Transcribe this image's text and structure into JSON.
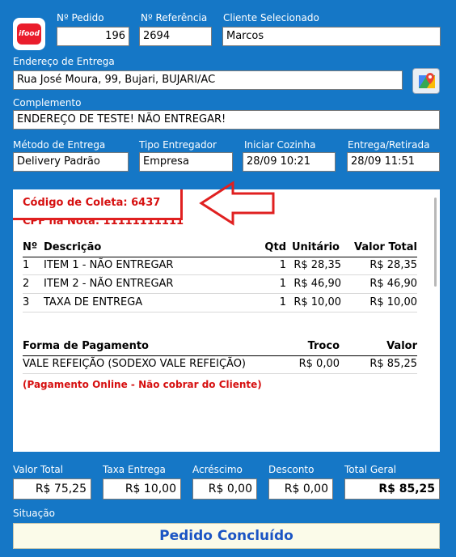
{
  "logo": {
    "text": "ifood"
  },
  "header": {
    "pedido_label": "Nº Pedido",
    "pedido_value": "196",
    "referencia_label": "Nº Referência",
    "referencia_value": "2694",
    "cliente_label": "Cliente Selecionado",
    "cliente_value": "Marcos"
  },
  "endereco": {
    "label": "Endereço de Entrega",
    "value": "Rua José Moura, 99, Bujari, BUJARI/AC"
  },
  "complemento": {
    "label": "Complemento",
    "value": "ENDEREÇO DE TESTE! NÃO ENTREGAR!"
  },
  "entrega": {
    "metodo_label": "Método de Entrega",
    "metodo_value": "Delivery Padrão",
    "tipo_label": "Tipo Entregador",
    "tipo_value": "Empresa",
    "cozinha_label": "Iniciar Cozinha",
    "cozinha_value": "28/09 10:21",
    "retirada_label": "Entrega/Retirada",
    "retirada_value": "28/09 11:51"
  },
  "receipt": {
    "codigo_coleta": "Código de Coleta: 6437",
    "cpf": "CPF na Nota: 11111111111",
    "items_header": {
      "num": "Nº",
      "descricao": "Descrição",
      "qtd": "Qtd",
      "unitario": "Unitário",
      "total": "Valor Total"
    },
    "items": [
      {
        "num": "1",
        "descricao": "ITEM 1 - NÃO ENTREGAR",
        "qtd": "1",
        "unitario": "R$ 28,35",
        "total": "R$ 28,35"
      },
      {
        "num": "2",
        "descricao": "ITEM 2 - NÃO ENTREGAR",
        "qtd": "1",
        "unitario": "R$ 46,90",
        "total": "R$ 46,90"
      },
      {
        "num": "3",
        "descricao": "TAXA DE ENTREGA",
        "qtd": "1",
        "unitario": "R$ 10,00",
        "total": "R$ 10,00"
      }
    ],
    "payment_header": {
      "forma": "Forma de Pagamento",
      "troco": "Troco",
      "valor": "Valor"
    },
    "payment": {
      "forma": "VALE REFEIÇÃO (SODEXO VALE REFEIÇÃO)",
      "troco": "R$ 0,00",
      "valor": "R$ 85,25"
    },
    "online_note": "(Pagamento Online - Não cobrar do Cliente)"
  },
  "totals": {
    "valor_total_label": "Valor Total",
    "valor_total": "R$ 75,25",
    "taxa_label": "Taxa Entrega",
    "taxa": "R$ 10,00",
    "acrescimo_label": "Acréscimo",
    "acrescimo": "R$ 0,00",
    "desconto_label": "Desconto",
    "desconto": "R$ 0,00",
    "geral_label": "Total Geral",
    "geral": "R$ 85,25"
  },
  "situacao": {
    "label": "Situação",
    "value": "Pedido Concluído"
  },
  "colors": {
    "background": "#1577c6",
    "annotation_red": "#e02020",
    "status_text": "#1b55c4"
  }
}
